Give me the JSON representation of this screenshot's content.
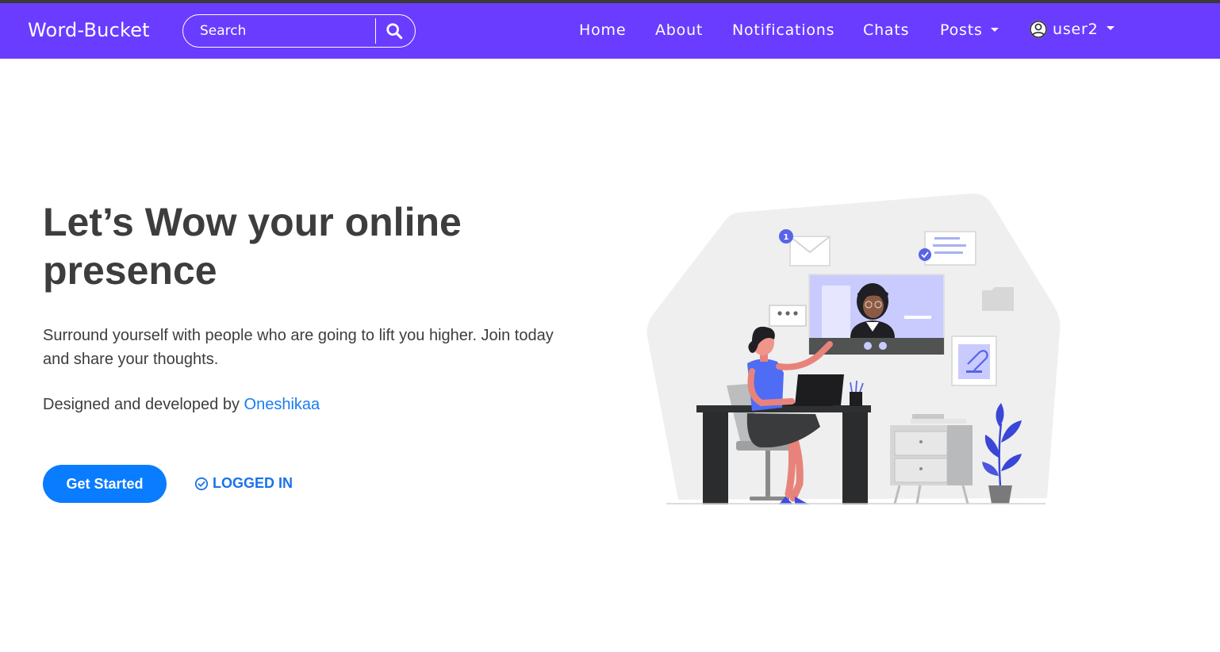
{
  "navbar": {
    "brand": "Word-Bucket",
    "search_placeholder": "Search",
    "links": {
      "home": "Home",
      "about": "About",
      "notifications": "Notifications",
      "chats": "Chats",
      "posts": "Posts",
      "user": "user2"
    }
  },
  "hero": {
    "title": "Let’s Wow your online presence",
    "text": "Surround yourself with people who are going to lift you higher. Join today and share your thoughts.",
    "credit_prefix": "Designed and developed by ",
    "credit_link": "Oneshikaa",
    "start_button": "Get Started",
    "status": "LOGGED IN"
  },
  "illustration": {
    "notification_count": "1"
  },
  "colors": {
    "navbar": "#6a3cff",
    "primary": "#0a7cff",
    "link": "#1a7cf0",
    "text": "#3d3d3d",
    "accent": "#5864e8"
  },
  "icons": [
    "search-icon",
    "user-circle-icon",
    "check-circle-icon",
    "chevron-down-icon"
  ]
}
